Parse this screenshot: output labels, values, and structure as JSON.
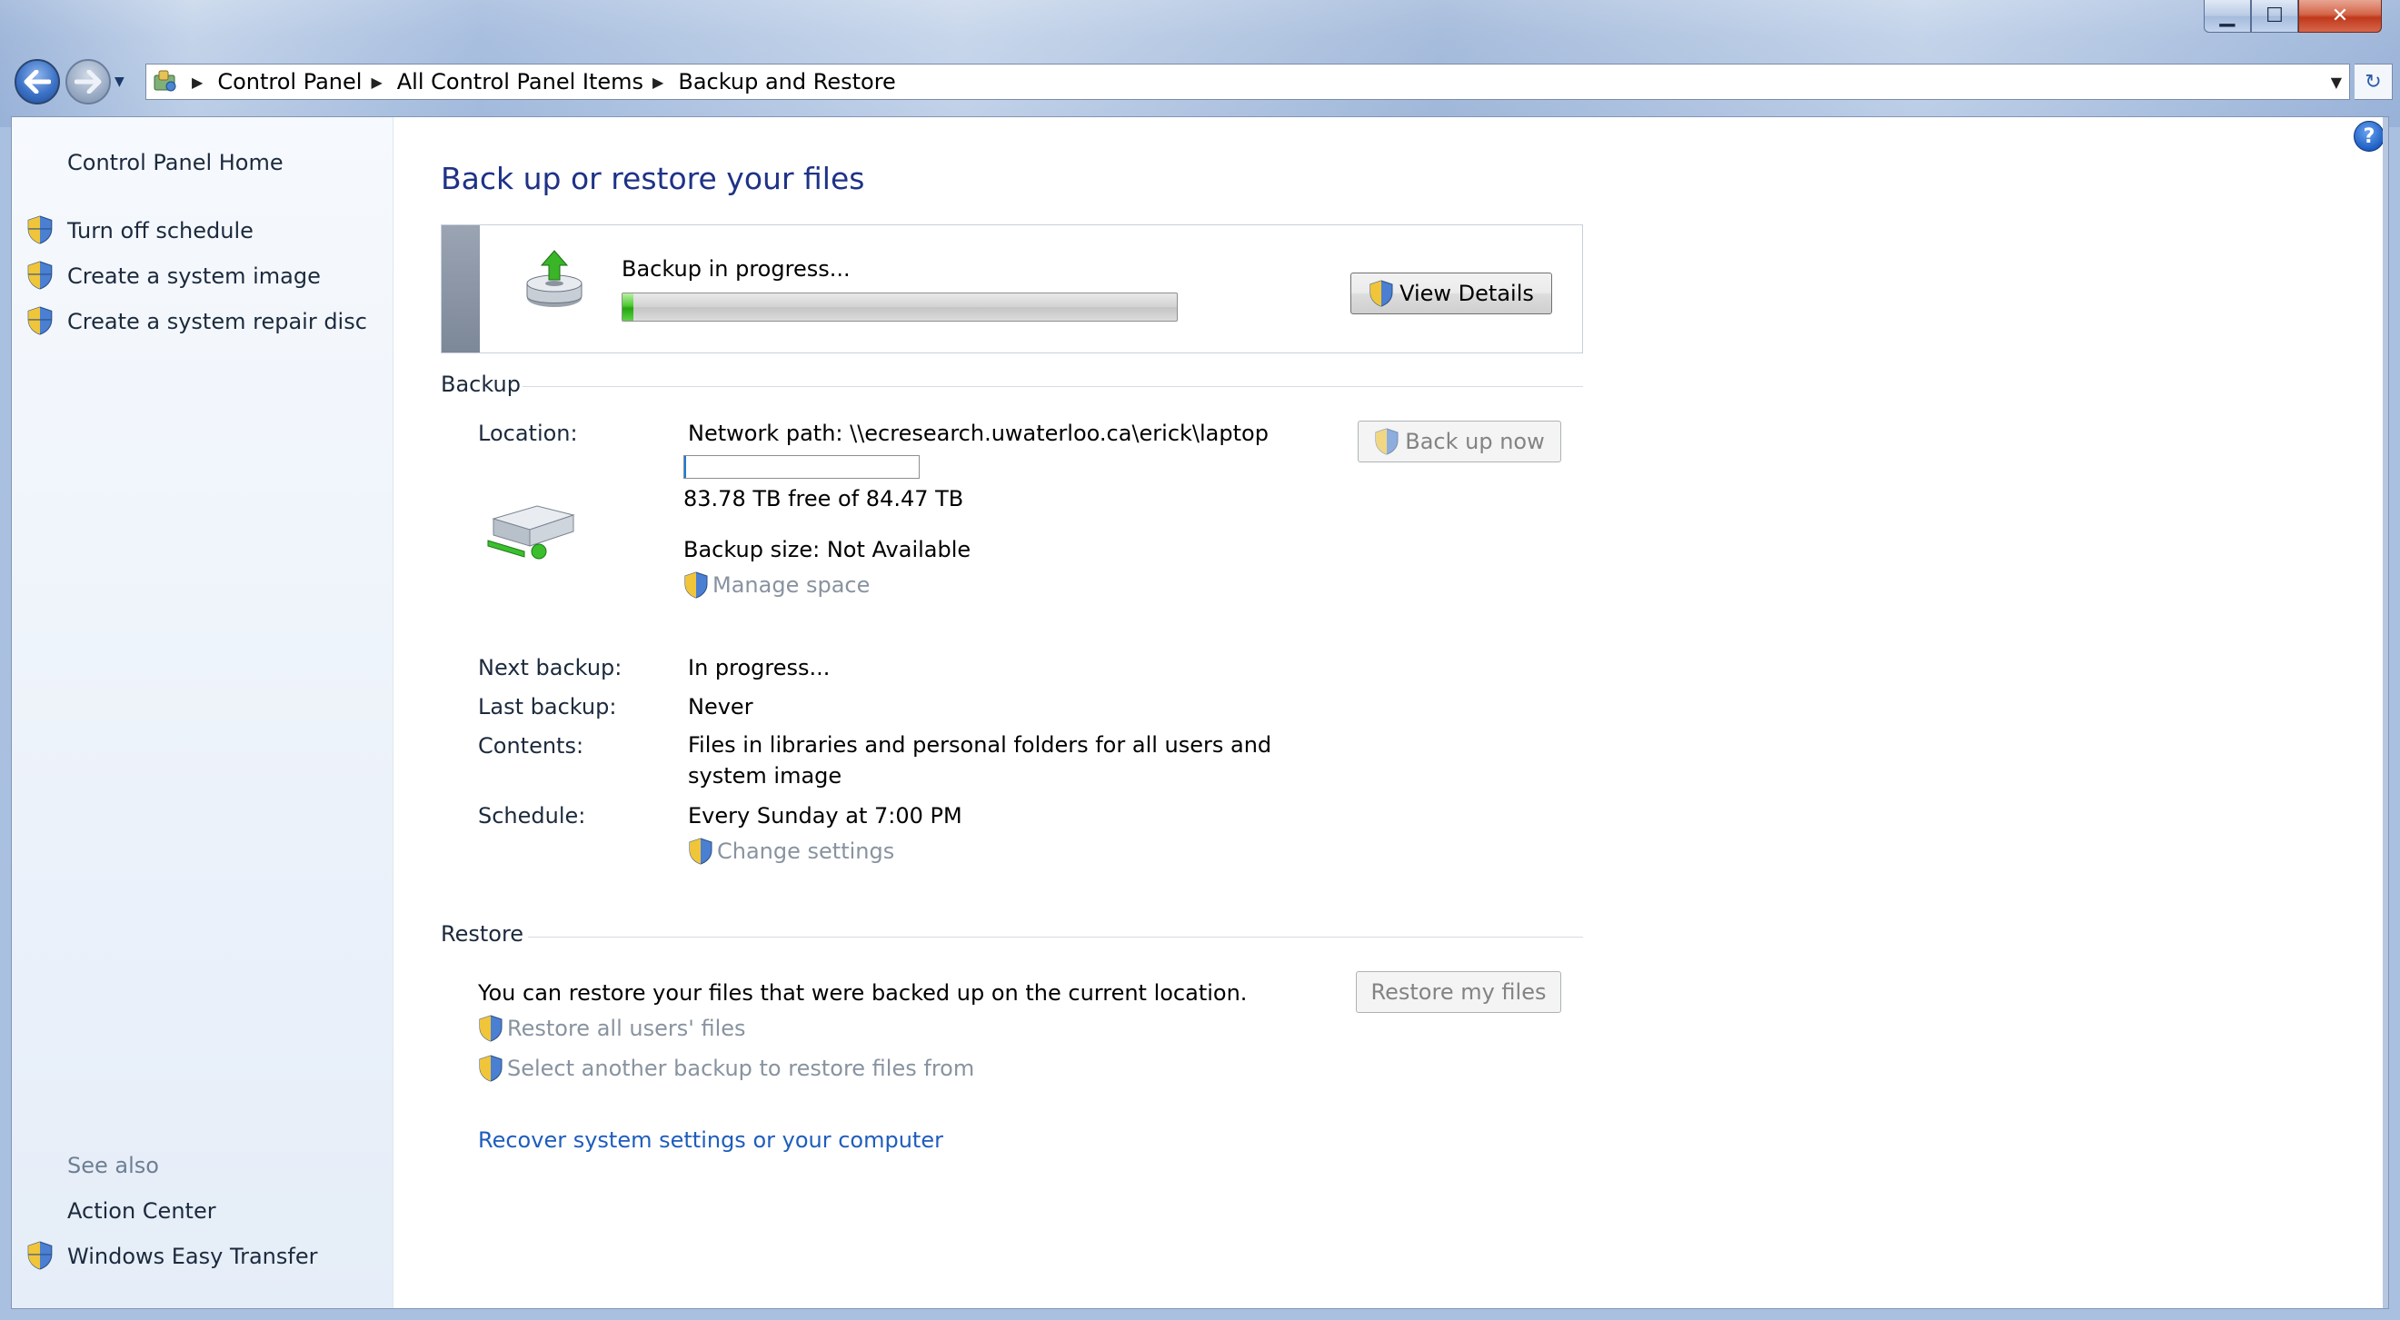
{
  "window": {
    "caption_buttons": {
      "minimize": "▁",
      "maximize": "☐",
      "close": "✕"
    }
  },
  "navigation": {
    "back_icon": "arrow-left-icon",
    "forward_icon": "arrow-right-icon",
    "breadcrumbs": [
      "Control Panel",
      "All Control Panel Items",
      "Backup and Restore"
    ],
    "dropdown_glyph": "▼",
    "refresh_glyph": "↻"
  },
  "sidebar": {
    "home": "Control Panel Home",
    "tasks": [
      {
        "label": "Turn off schedule"
      },
      {
        "label": "Create a system image"
      },
      {
        "label": "Create a system repair disc"
      }
    ],
    "see_also_label": "See also",
    "see_also": [
      {
        "label": "Action Center",
        "shield": false
      },
      {
        "label": "Windows Easy Transfer",
        "shield": true
      }
    ]
  },
  "main": {
    "title": "Back up or restore your files",
    "help_glyph": "?",
    "progress": {
      "status": "Backup in progress...",
      "fraction": 0.02,
      "view_details": "View Details"
    },
    "backup": {
      "heading": "Backup",
      "location_label": "Location:",
      "location_value": "Network path: \\\\ecresearch.uwaterloo.ca\\erick\\laptop",
      "space_used_fraction": 0.008,
      "free_space": "83.78 TB free of 84.47 TB",
      "backup_size": "Backup size: Not Available",
      "manage_space": "Manage space",
      "back_up_now": "Back up now",
      "next_backup_label": "Next backup:",
      "next_backup_value": "In progress...",
      "last_backup_label": "Last backup:",
      "last_backup_value": "Never",
      "contents_label": "Contents:",
      "contents_value": "Files in libraries and personal folders for all users and system image",
      "schedule_label": "Schedule:",
      "schedule_value": "Every Sunday at 7:00 PM",
      "change_settings": "Change settings"
    },
    "restore": {
      "heading": "Restore",
      "description": "You can restore your files that were backed up on the current location.",
      "restore_my_files": "Restore my files",
      "restore_all_users": "Restore all users' files",
      "select_another": "Select another backup to restore files from",
      "recover_link": "Recover system settings or your computer"
    }
  },
  "colors": {
    "title_blue": "#1e3287",
    "link_blue": "#1e5dbd",
    "disabled_gray": "#8893a0",
    "progress_green": "#24a70e"
  }
}
